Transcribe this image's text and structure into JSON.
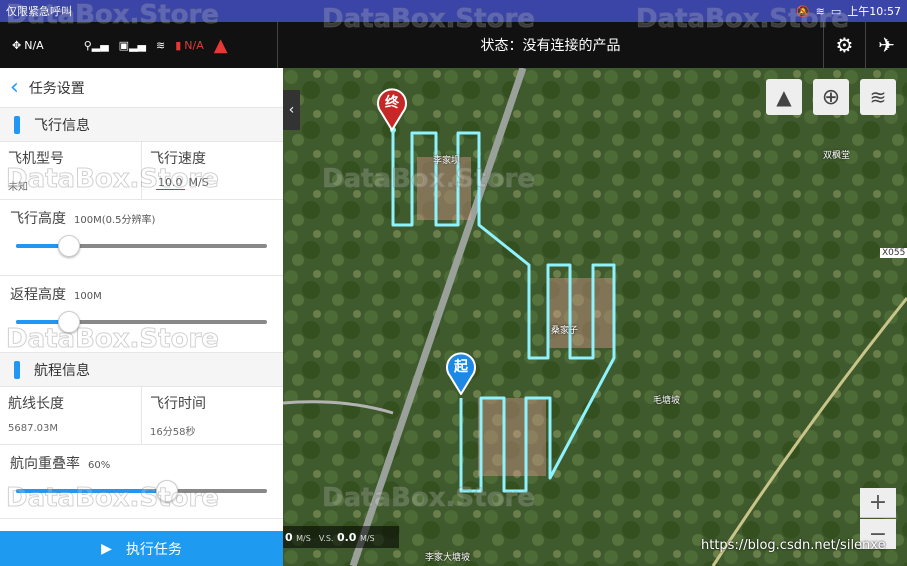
{
  "statusbar": {
    "left": "仅限紧急呼叫",
    "time": "上午10:57"
  },
  "topbar": {
    "drone_value": "N/A",
    "rc_value": "N/A",
    "status_text": "状态：没有连接的产品"
  },
  "panel": {
    "title": "任务设置",
    "flight_section": "飞行信息",
    "model_label": "飞机型号",
    "model_value": "未知",
    "speed_label": "飞行速度",
    "speed_value": "10.0",
    "speed_unit": "M/S",
    "altitude_label": "飞行高度",
    "altitude_hint": "100M(0.5分辨率)",
    "altitude_level": 0.21,
    "return_label": "返程高度",
    "return_hint": "100M",
    "return_level": 0.21,
    "route_section": "航程信息",
    "length_label": "航线长度",
    "length_value": "5687.03M",
    "time_label": "飞行时间",
    "time_value": "16分58秒",
    "overlap_label": "航向重叠率",
    "overlap_hint": "60%",
    "overlap_level": 0.6,
    "execute_label": "执行任务"
  },
  "map": {
    "speed1": "0",
    "speed1_unit": "M/S",
    "vs_label": "V.S.",
    "speed2": "0.0",
    "speed2_unit": "M/S",
    "end_marker": "终",
    "start_marker": "起",
    "labels": [
      "李家坝",
      "桑家子",
      "毛塘坡",
      "双枫堂",
      "X055",
      "李家大塘坡"
    ],
    "zoom_in": "+",
    "zoom_out": "−"
  },
  "watermark": "DataBox.Store",
  "credit": "https://blog.csdn.net/silenxe",
  "colors": {
    "accent": "#1e9bf0",
    "route": "#8ff3ff",
    "statusbar": "#3b45a8"
  }
}
